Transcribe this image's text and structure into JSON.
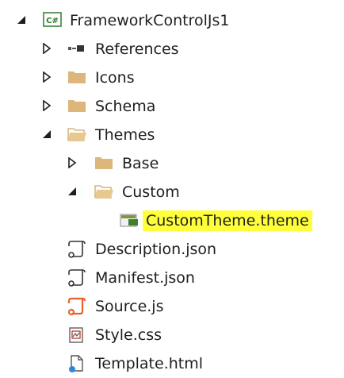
{
  "tree": {
    "project": {
      "label": "FrameworkControlJs1",
      "icon": "csharp-project-icon",
      "badge": "C#",
      "expanded": true,
      "children": [
        {
          "label": "References",
          "icon": "references-icon",
          "expanded": false
        },
        {
          "label": "Icons",
          "icon": "folder-icon",
          "expanded": false
        },
        {
          "label": "Schema",
          "icon": "folder-icon",
          "expanded": false
        },
        {
          "label": "Themes",
          "icon": "folder-open-icon",
          "expanded": true,
          "children": [
            {
              "label": "Base",
              "icon": "folder-icon",
              "expanded": false
            },
            {
              "label": "Custom",
              "icon": "folder-open-icon",
              "expanded": true,
              "children": [
                {
                  "label": "CustomTheme.theme",
                  "icon": "theme-file-icon",
                  "selected": true
                }
              ]
            }
          ]
        },
        {
          "label": "Description.json",
          "icon": "json-file-icon"
        },
        {
          "label": "Manifest.json",
          "icon": "json-file-icon"
        },
        {
          "label": "Source.js",
          "icon": "js-file-icon"
        },
        {
          "label": "Style.css",
          "icon": "css-file-icon"
        },
        {
          "label": "Template.html",
          "icon": "html-file-icon"
        }
      ]
    }
  },
  "colors": {
    "selection": "#ffff3b",
    "folder": "#dcb67a",
    "folder_open": "#e8c88d",
    "js": "#e8612c",
    "project_badge": "#2d7d2d",
    "text": "#1e1e1e"
  }
}
